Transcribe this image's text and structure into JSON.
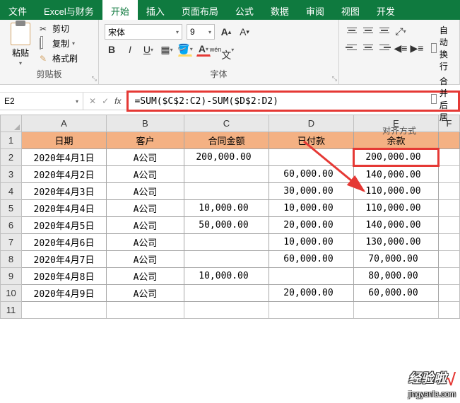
{
  "tabs": {
    "file": "文件",
    "custom": "Excel与财务",
    "home": "开始",
    "insert": "插入",
    "layout": "页面布局",
    "formula": "公式",
    "data": "数据",
    "review": "审阅",
    "view": "视图",
    "dev": "开发"
  },
  "ribbon": {
    "clipboard": {
      "paste": "粘贴",
      "cut": "剪切",
      "copy": "复制",
      "format_painter": "格式刷",
      "group_label": "剪贴板"
    },
    "font": {
      "name": "宋体",
      "size": "9",
      "bold": "B",
      "italic": "I",
      "underline": "U",
      "group_label": "字体"
    },
    "align": {
      "wrap": "自动换行",
      "merge": "合并后居",
      "group_label": "对齐方式"
    }
  },
  "namebox": "E2",
  "formula": "=SUM($C$2:C2)-SUM($D$2:D2)",
  "columns": [
    "A",
    "B",
    "C",
    "D",
    "E",
    "F"
  ],
  "row_labels": [
    "1",
    "2",
    "3",
    "4",
    "5",
    "6",
    "7",
    "8",
    "9",
    "10",
    "11"
  ],
  "headers": {
    "a": "日期",
    "b": "客户",
    "c": "合同金额",
    "d": "已付款",
    "e": "余款"
  },
  "rows": [
    {
      "date": "2020年4月1日",
      "cust": "A公司",
      "amt": "200,000.00",
      "paid": "",
      "bal": "200,000.00"
    },
    {
      "date": "2020年4月2日",
      "cust": "A公司",
      "amt": "",
      "paid": "60,000.00",
      "bal": "140,000.00"
    },
    {
      "date": "2020年4月3日",
      "cust": "A公司",
      "amt": "",
      "paid": "30,000.00",
      "bal": "110,000.00"
    },
    {
      "date": "2020年4月4日",
      "cust": "A公司",
      "amt": "10,000.00",
      "paid": "10,000.00",
      "bal": "110,000.00"
    },
    {
      "date": "2020年4月5日",
      "cust": "A公司",
      "amt": "50,000.00",
      "paid": "20,000.00",
      "bal": "140,000.00"
    },
    {
      "date": "2020年4月6日",
      "cust": "A公司",
      "amt": "",
      "paid": "10,000.00",
      "bal": "130,000.00"
    },
    {
      "date": "2020年4月7日",
      "cust": "A公司",
      "amt": "",
      "paid": "60,000.00",
      "bal": "70,000.00"
    },
    {
      "date": "2020年4月8日",
      "cust": "A公司",
      "amt": "10,000.00",
      "paid": "",
      "bal": "80,000.00"
    },
    {
      "date": "2020年4月9日",
      "cust": "A公司",
      "amt": "",
      "paid": "20,000.00",
      "bal": "60,000.00"
    }
  ],
  "watermark": {
    "top": "经验啦",
    "check": "√",
    "bottom": "jingyanla.com"
  }
}
